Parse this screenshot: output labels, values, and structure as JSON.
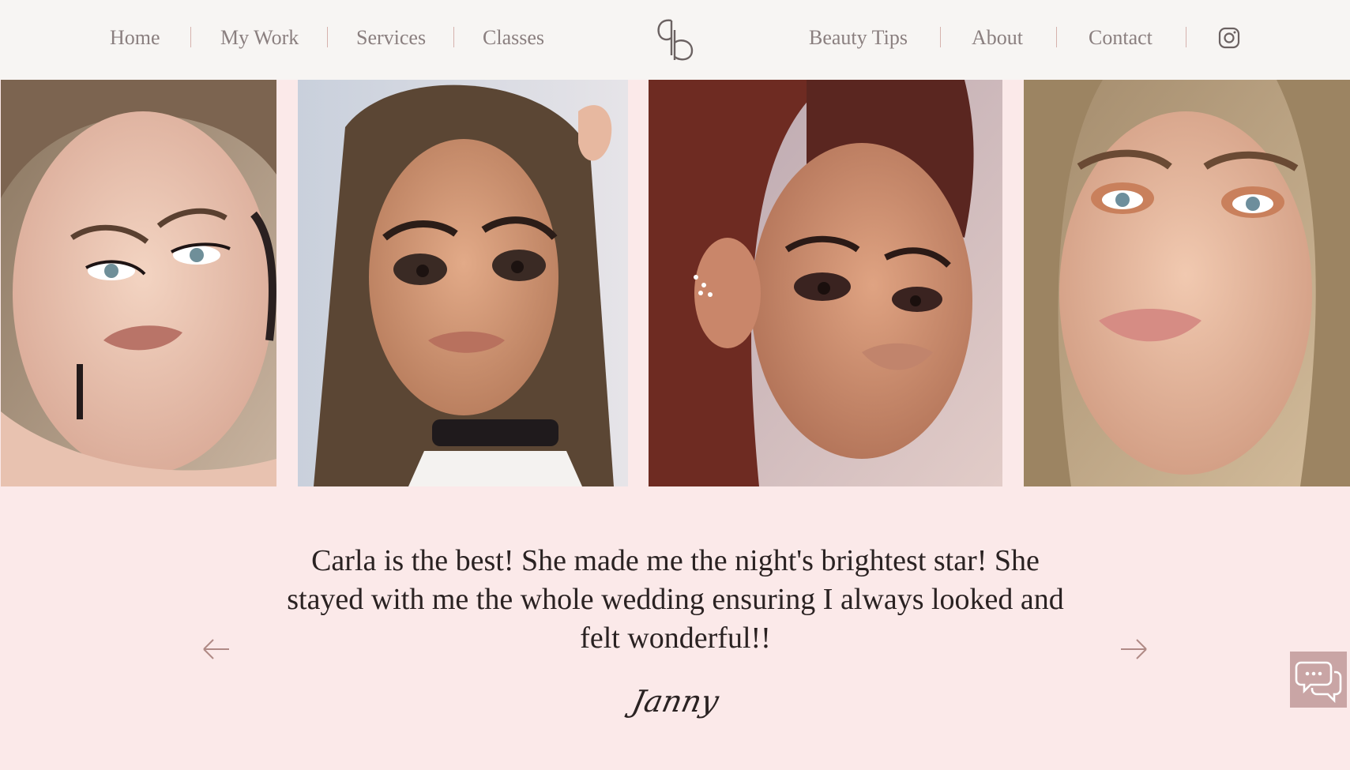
{
  "header": {
    "nav_left": [
      {
        "label": "Home"
      },
      {
        "label": "My Work"
      },
      {
        "label": "Services"
      },
      {
        "label": "Classes"
      }
    ],
    "nav_right": [
      {
        "label": "Beauty Tips"
      },
      {
        "label": "About"
      },
      {
        "label": "Contact"
      }
    ],
    "logo_icon": "cb-monogram-logo",
    "social_icon": "instagram-icon"
  },
  "gallery": {
    "photos": [
      {
        "description": "woman with light brown hair, winged eyeliner, drop earrings"
      },
      {
        "description": "woman with long brown wavy hair, smoky eyes, black choker"
      },
      {
        "description": "woman with curly auburn hair, smoky eyes, ear cuff"
      },
      {
        "description": "woman with blonde hair, copper glitter eyeshadow"
      }
    ]
  },
  "testimonial": {
    "quote": "Carla is the best! She made me the night's brightest star! She stayed with me the whole  wedding ensuring I always looked and felt wonderful!!",
    "author": "Janny",
    "prev_icon": "arrow-left-icon",
    "next_icon": "arrow-right-icon"
  },
  "chat": {
    "icon": "chat-bubbles-icon"
  },
  "colors": {
    "header_bg": "#f7f5f3",
    "page_bg": "#fbe9e9",
    "nav_text": "#8a7f7f",
    "separator": "#d6b2ad",
    "accent": "#c9a5a5",
    "quote_text": "#2a2222"
  }
}
